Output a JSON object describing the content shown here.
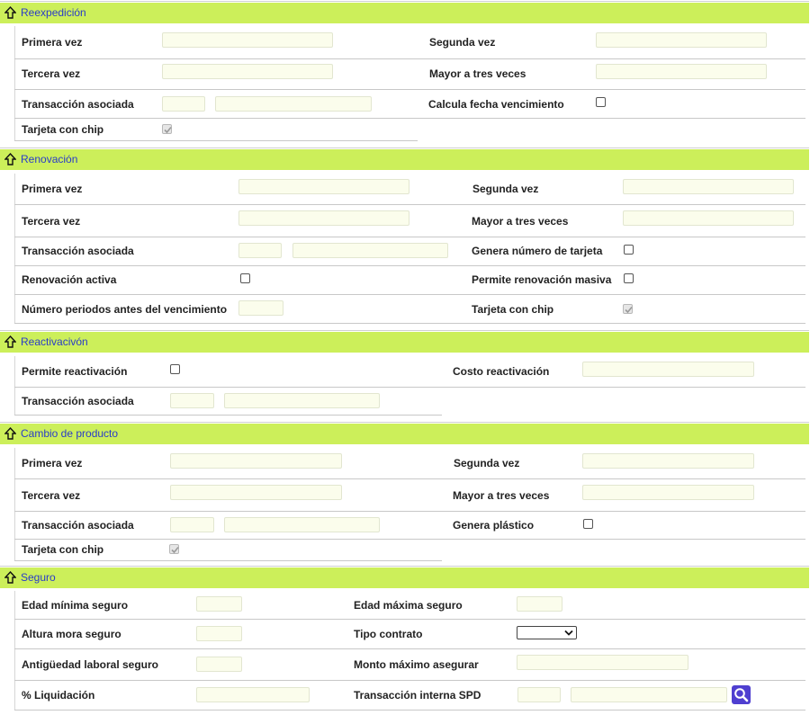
{
  "colors": {
    "header_bg": "#ccef5a",
    "header_text": "#2a3cc8",
    "input_bg": "#fbfdec",
    "search_btn": "#4f3fd0"
  },
  "icons": {
    "section_toggle": "up-arrow-icon",
    "search": "search-icon"
  },
  "reexpedicion": {
    "title": "Reexpedición",
    "primera_vez": {
      "label": "Primera vez",
      "value": ""
    },
    "segunda_vez": {
      "label": "Segunda vez",
      "value": ""
    },
    "tercera_vez": {
      "label": "Tercera vez",
      "value": ""
    },
    "mayor_tres": {
      "label": "Mayor a tres veces",
      "value": ""
    },
    "transaccion_asociada": {
      "label": "Transacción asociada",
      "code": "",
      "desc": ""
    },
    "calcula_fecha": {
      "label": "Calcula fecha vencimiento",
      "checked": false
    },
    "tarjeta_chip": {
      "label": "Tarjeta con chip",
      "checked": true,
      "disabled": true
    }
  },
  "renovacion": {
    "title": "Renovación",
    "primera_vez": {
      "label": "Primera vez",
      "value": ""
    },
    "segunda_vez": {
      "label": "Segunda vez",
      "value": ""
    },
    "tercera_vez": {
      "label": "Tercera vez",
      "value": ""
    },
    "mayor_tres": {
      "label": "Mayor a tres veces",
      "value": ""
    },
    "transaccion_asociada": {
      "label": "Transacción asociada",
      "code": "",
      "desc": ""
    },
    "genera_numero": {
      "label": "Genera número de tarjeta",
      "checked": false
    },
    "renovacion_activa": {
      "label": "Renovación activa",
      "checked": false
    },
    "permite_masiva": {
      "label": "Permite renovación masiva",
      "checked": false
    },
    "numero_periodos": {
      "label": "Número periodos antes del vencimiento",
      "value": ""
    },
    "tarjeta_chip": {
      "label": "Tarjeta con chip",
      "checked": true,
      "disabled": true
    }
  },
  "reactivacion": {
    "title": "Reactivacivón",
    "permite": {
      "label": "Permite reactivación",
      "checked": false
    },
    "costo": {
      "label": "Costo reactivación",
      "value": ""
    },
    "transaccion_asociada": {
      "label": "Transacción asociada",
      "code": "",
      "desc": ""
    }
  },
  "cambio_producto": {
    "title": "Cambio de producto",
    "primera_vez": {
      "label": "Primera vez",
      "value": ""
    },
    "segunda_vez": {
      "label": "Segunda vez",
      "value": ""
    },
    "tercera_vez": {
      "label": "Tercera vez",
      "value": ""
    },
    "mayor_tres": {
      "label": "Mayor a tres veces",
      "value": ""
    },
    "transaccion_asociada": {
      "label": "Transacción asociada",
      "code": "",
      "desc": ""
    },
    "genera_plastico": {
      "label": "Genera plástico",
      "checked": false
    },
    "tarjeta_chip": {
      "label": "Tarjeta con chip",
      "checked": true,
      "disabled": true
    }
  },
  "seguro": {
    "title": "Seguro",
    "edad_minima": {
      "label": "Edad mínima seguro",
      "value": ""
    },
    "edad_maxima": {
      "label": "Edad máxima seguro",
      "value": ""
    },
    "altura_mora": {
      "label": "Altura mora seguro",
      "value": ""
    },
    "tipo_contrato": {
      "label": "Tipo contrato",
      "selected": ""
    },
    "antiguedad": {
      "label": "Antigüedad laboral seguro",
      "value": ""
    },
    "monto_maximo": {
      "label": "Monto máximo asegurar",
      "value": ""
    },
    "liquidacion": {
      "label": "% Liquidación",
      "value": ""
    },
    "transaccion_spd": {
      "label": "Transacción interna SPD",
      "code": "",
      "desc": ""
    }
  }
}
